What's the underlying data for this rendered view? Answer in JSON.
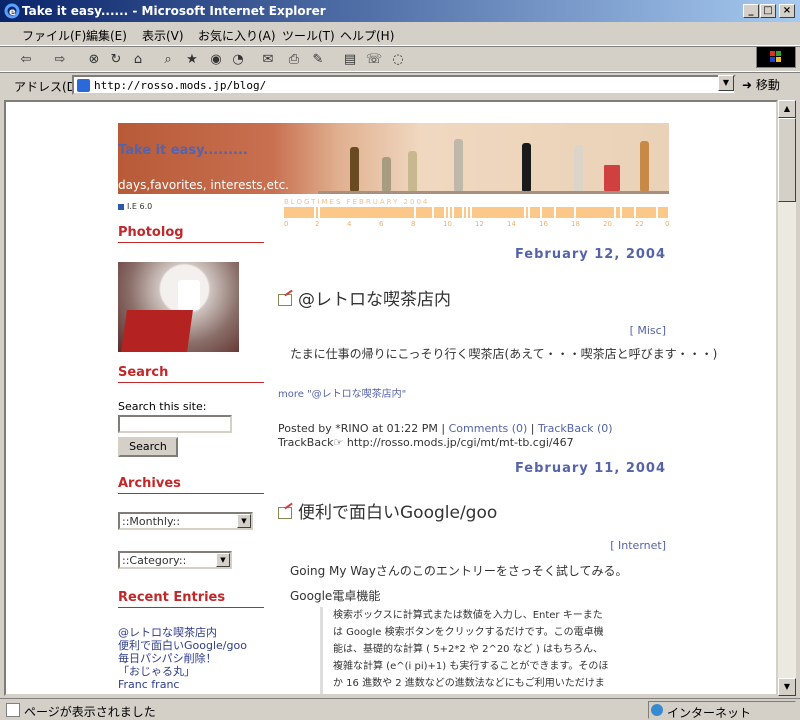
{
  "window": {
    "title": "Take it easy...... - Microsoft Internet Explorer",
    "minimize": "_",
    "maximize": "□",
    "close": "×"
  },
  "menu": [
    "ファイル(F)",
    "編集(E)",
    "表示(V)",
    "お気に入り(A)",
    "ツール(T)",
    "ヘルプ(H)"
  ],
  "toolbar_icons": [
    "back-icon",
    "forward-icon",
    "stop-icon",
    "refresh-icon",
    "home-icon",
    "search-icon",
    "favorites-icon",
    "media-icon",
    "history-icon",
    "mail-icon",
    "print-icon",
    "edit-icon",
    "discuss-icon",
    "messenger-icon"
  ],
  "address": {
    "label": "アドレス(D)",
    "url": "http://rosso.mods.jp/blog/",
    "go": "移動"
  },
  "status": {
    "text": "ページが表示されました",
    "zone": "インターネット"
  },
  "blog": {
    "title": "Take it easy.........",
    "description": "days,favorites, interests,etc.",
    "browser_badge": "I.E 6.0",
    "blogtimes_label": "BLOGTIMES   FEBRUARY 2004",
    "blogtimes_ticks": [
      "0",
      "2",
      "4",
      "6",
      "8",
      "10",
      "12",
      "14",
      "16",
      "18",
      "20",
      "22",
      "0"
    ]
  },
  "sidebar": {
    "photolog_heading": "Photolog",
    "search_heading": "Search",
    "search_label": "Search this site:",
    "search_button": "Search",
    "archives_heading": "Archives",
    "monthly_select": "::Monthly::",
    "category_select": "::Category::",
    "recent_heading": "Recent Entries",
    "recent_entries": [
      "@レトロな喫茶店内",
      "便利で面白いGoogle/goo",
      "毎日パシパシ削除！",
      "「おじゃる丸」",
      "Franc franc"
    ]
  },
  "posts": [
    {
      "date": "February 12, 2004",
      "title": "@レトロな喫茶店内",
      "category": "[ Misc]",
      "body": "たまに仕事の帰りにこっそり行く喫茶店(あえて・・・喫茶店と呼びます・・・)",
      "more": "more \"@レトロな喫茶店内\"",
      "footer": {
        "posted": "Posted by *RINO at 01:22 PM",
        "comments": "Comments (0)",
        "trackback": "TrackBack (0)",
        "tb_label": "TrackBack",
        "tb_url": "http://rosso.mods.jp/cgi/mt/mt-tb.cgi/467"
      }
    },
    {
      "date": "February 11, 2004",
      "title": "便利で面白いGoogle/goo",
      "category": "[ Internet]",
      "body1": "Going My Wayさんのこのエントリーをさっそく試してみる。",
      "body2": "Google電卓機能",
      "quote": "検索ボックスに計算式または数値を入力し、Enter キーまたは Google 検索ボタンをクリックするだけです。この電卓機能は、基礎的な計算 ( 5+2*2 や 2^20 など ) はもちろん、複雑な計算 (e^(i pi)+1) も実行することができます。そのほか 16 進数や 2 進数などの進数法などにもご利用いただけます。なお、数字は半"
    }
  ]
}
